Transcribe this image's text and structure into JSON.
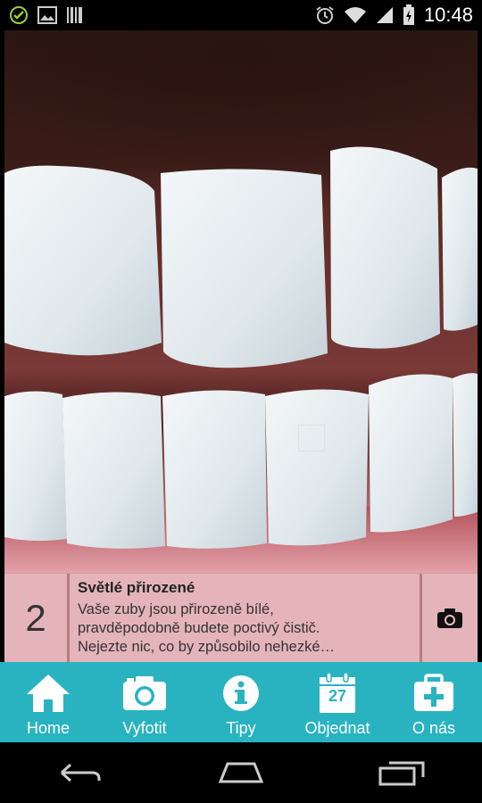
{
  "status_bar": {
    "time": "10:48",
    "icons": [
      "check-circle-icon",
      "image-icon",
      "barcode-icon",
      "alarm-icon",
      "wifi-icon",
      "signal-icon",
      "battery-charging-icon"
    ]
  },
  "result": {
    "number": "2",
    "title": "Světlé přirozené",
    "description_lines": [
      "Vaše zuby jsou přirozeně bílé,",
      "pravděpodobně budete poctivý čistič.",
      "Nejezte nic, co by způsobilo nehezké…"
    ]
  },
  "tabs": [
    {
      "label": "Home",
      "icon": "home-icon"
    },
    {
      "label": "Vyfotit",
      "icon": "camera-icon"
    },
    {
      "label": "Tipy",
      "icon": "info-icon"
    },
    {
      "label": "Objednat",
      "icon": "calendar-icon",
      "icon_text": "27"
    },
    {
      "label": "O nás",
      "icon": "medical-kit-icon"
    }
  ],
  "colors": {
    "tabbar": "#29b3c0",
    "info_panel": "#f0bec4"
  }
}
